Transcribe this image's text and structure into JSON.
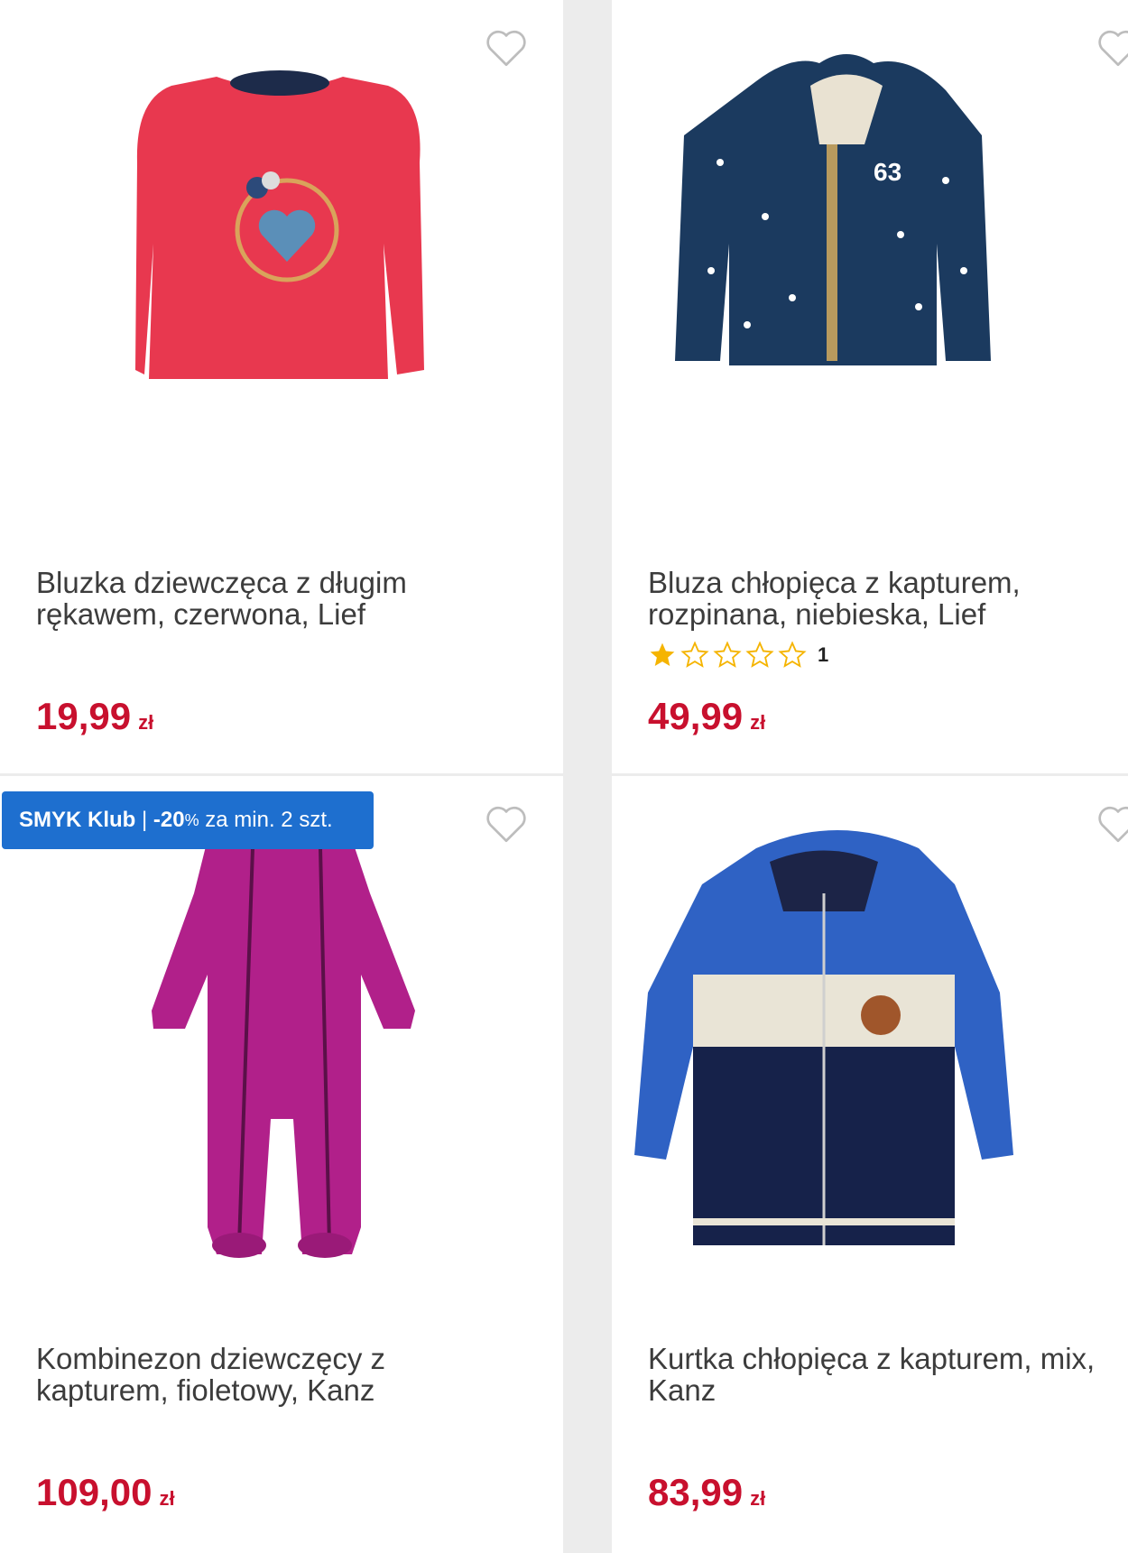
{
  "products": [
    {
      "title": "Bluzka dziewczęca z długim rękawem, czerwona, Lief",
      "price": "19,99",
      "currency": "zł"
    },
    {
      "title": "Bluza chłopięca z kapturem, rozpinana, niebieska, Lief",
      "price": "49,99",
      "currency": "zł",
      "rating": {
        "stars": 1,
        "max": 5,
        "count": "1"
      }
    },
    {
      "title": "Kombinezon dziewczęcy z kapturem, fioletowy, Kanz",
      "price": "109,00",
      "currency": "zł",
      "badge": {
        "brand": "SMYK Klub",
        "separator": " | ",
        "discount": "-20",
        "percent": "%",
        "text": " za min. 2 szt."
      }
    },
    {
      "title": "Kurtka chłopięca z kapturem, mix, Kanz",
      "price": "83,99",
      "currency": "zł"
    }
  ],
  "icons": {
    "favorite": "heart-outline-icon",
    "star_filled": "star-filled-icon",
    "star_empty": "star-outline-icon"
  },
  "colors": {
    "price": "#c8102e",
    "badge": "#1e6fcf",
    "star": "#f5b400"
  }
}
